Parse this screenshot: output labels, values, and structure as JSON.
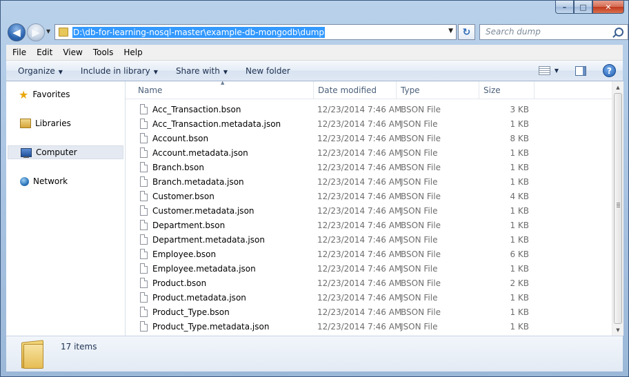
{
  "window": {
    "caption_buttons": {
      "minimize": "–",
      "maximize": "□",
      "close": "✕"
    }
  },
  "nav": {
    "back_glyph": "◀",
    "forward_glyph": "▶",
    "address_path": "D:\\db-for-learning-nosql-master\\example-db-mongodb\\dump",
    "search_placeholder": "Search dump",
    "refresh_glyph": "↻"
  },
  "menu": [
    "File",
    "Edit",
    "View",
    "Tools",
    "Help"
  ],
  "toolbar": {
    "organize": "Organize",
    "include_in_library": "Include in library",
    "share_with": "Share with",
    "new_folder": "New folder",
    "help_glyph": "?"
  },
  "sidebar": {
    "items": [
      {
        "label": "Favorites",
        "icon": "favorites-star-icon"
      },
      {
        "label": "Libraries",
        "icon": "libraries-icon"
      },
      {
        "label": "Computer",
        "icon": "computer-icon",
        "selected": true
      },
      {
        "label": "Network",
        "icon": "network-icon"
      }
    ]
  },
  "columns": {
    "name": "Name",
    "date_modified": "Date modified",
    "type": "Type",
    "size": "Size"
  },
  "files": [
    {
      "name": "Acc_Transaction.bson",
      "date": "12/23/2014 7:46 AM",
      "type": "BSON File",
      "size": "3 KB"
    },
    {
      "name": "Acc_Transaction.metadata.json",
      "date": "12/23/2014 7:46 AM",
      "type": "JSON File",
      "size": "1 KB"
    },
    {
      "name": "Account.bson",
      "date": "12/23/2014 7:46 AM",
      "type": "BSON File",
      "size": "8 KB"
    },
    {
      "name": "Account.metadata.json",
      "date": "12/23/2014 7:46 AM",
      "type": "JSON File",
      "size": "1 KB"
    },
    {
      "name": "Branch.bson",
      "date": "12/23/2014 7:46 AM",
      "type": "BSON File",
      "size": "1 KB"
    },
    {
      "name": "Branch.metadata.json",
      "date": "12/23/2014 7:46 AM",
      "type": "JSON File",
      "size": "1 KB"
    },
    {
      "name": "Customer.bson",
      "date": "12/23/2014 7:46 AM",
      "type": "BSON File",
      "size": "4 KB"
    },
    {
      "name": "Customer.metadata.json",
      "date": "12/23/2014 7:46 AM",
      "type": "JSON File",
      "size": "1 KB"
    },
    {
      "name": "Department.bson",
      "date": "12/23/2014 7:46 AM",
      "type": "BSON File",
      "size": "1 KB"
    },
    {
      "name": "Department.metadata.json",
      "date": "12/23/2014 7:46 AM",
      "type": "JSON File",
      "size": "1 KB"
    },
    {
      "name": "Employee.bson",
      "date": "12/23/2014 7:46 AM",
      "type": "BSON File",
      "size": "6 KB"
    },
    {
      "name": "Employee.metadata.json",
      "date": "12/23/2014 7:46 AM",
      "type": "JSON File",
      "size": "1 KB"
    },
    {
      "name": "Product.bson",
      "date": "12/23/2014 7:46 AM",
      "type": "BSON File",
      "size": "2 KB"
    },
    {
      "name": "Product.metadata.json",
      "date": "12/23/2014 7:46 AM",
      "type": "JSON File",
      "size": "1 KB"
    },
    {
      "name": "Product_Type.bson",
      "date": "12/23/2014 7:46 AM",
      "type": "BSON File",
      "size": "1 KB"
    },
    {
      "name": "Product_Type.metadata.json",
      "date": "12/23/2014 7:46 AM",
      "type": "JSON File",
      "size": "1 KB"
    }
  ],
  "details": {
    "item_count": "17 items"
  },
  "colors": {
    "accent": "#3399ff",
    "frame": "#a6c1e0",
    "close": "#c0391d"
  }
}
